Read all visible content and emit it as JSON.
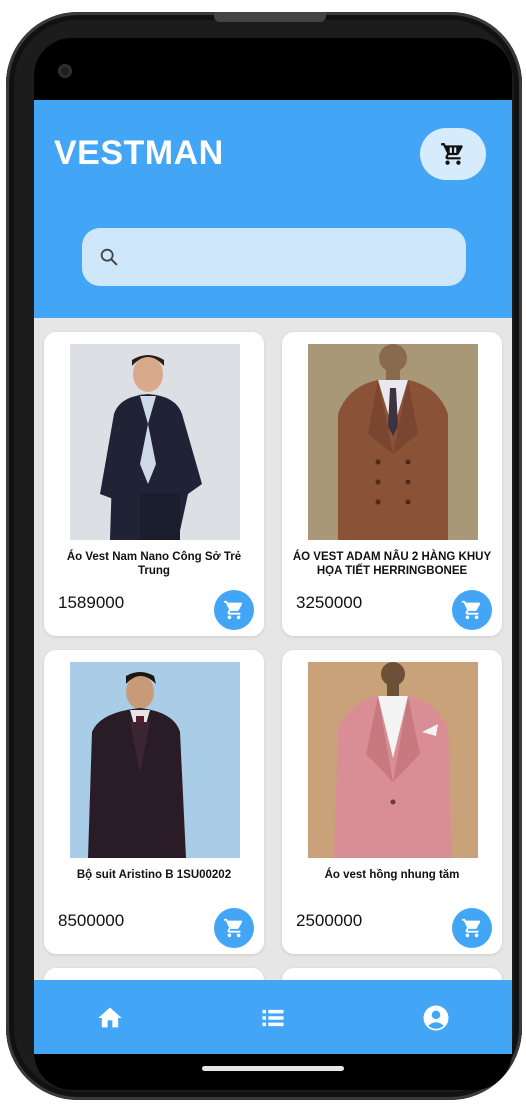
{
  "app": {
    "title": "VESTMAN",
    "accent_color": "#42a5f5",
    "header_cart_icon": "cart-icon"
  },
  "search": {
    "placeholder": "",
    "value": "",
    "icon": "search-icon"
  },
  "products": [
    {
      "name": "Áo Vest Nam Nano Công Sở Trẻ Trung",
      "price": "1589000",
      "image": "man-in-navy-suit-photo",
      "action_icon": "add-to-cart-icon"
    },
    {
      "name": "ÁO VEST ADAM NÂU 2 HÀNG KHUY HỌA TIẾT HERRINGBONEE",
      "price": "3250000",
      "image": "brown-double-breasted-blazer-photo",
      "action_icon": "add-to-cart-icon"
    },
    {
      "name": "Bộ suit Aristino B 1SU00202",
      "price": "8500000",
      "image": "man-in-burgundy-three-piece-suit-photo",
      "action_icon": "add-to-cart-icon"
    },
    {
      "name": "Áo vest hồng nhung tăm",
      "price": "2500000",
      "image": "pink-blazer-on-mannequin-photo",
      "action_icon": "add-to-cart-icon"
    }
  ],
  "bottom_nav": {
    "items": [
      {
        "icon": "home-icon"
      },
      {
        "icon": "list-icon"
      },
      {
        "icon": "account-icon"
      }
    ]
  }
}
